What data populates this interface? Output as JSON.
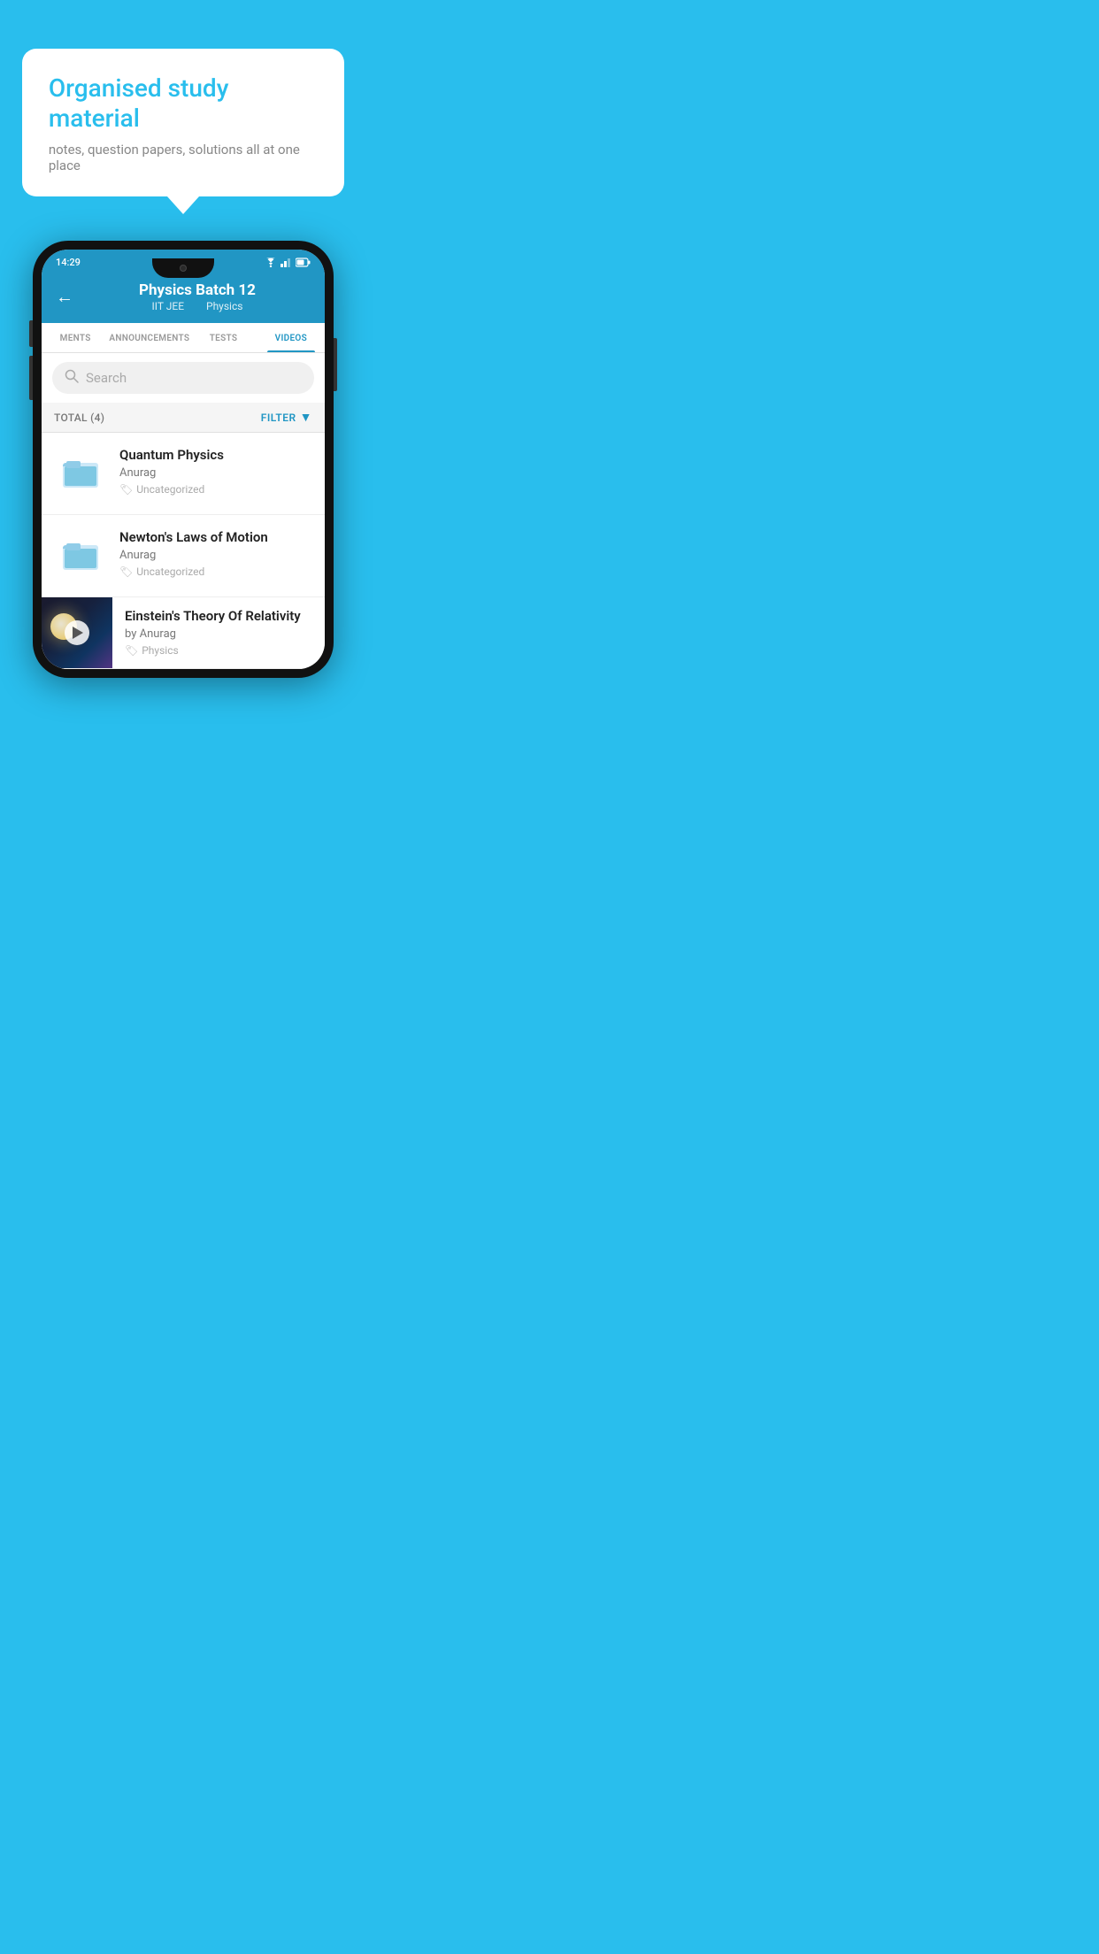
{
  "background_color": "#29BEED",
  "speech_bubble": {
    "title": "Organised study material",
    "subtitle": "notes, question papers, solutions all at one place"
  },
  "phone": {
    "status_bar": {
      "time": "14:29"
    },
    "header": {
      "title": "Physics Batch 12",
      "subtitle_left": "IIT JEE",
      "subtitle_right": "Physics",
      "back_label": "←"
    },
    "tabs": [
      {
        "label": "MENTS",
        "active": false
      },
      {
        "label": "ANNOUNCEMENTS",
        "active": false
      },
      {
        "label": "TESTS",
        "active": false
      },
      {
        "label": "VIDEOS",
        "active": true
      }
    ],
    "search": {
      "placeholder": "Search"
    },
    "filter_bar": {
      "total_label": "TOTAL (4)",
      "filter_label": "FILTER"
    },
    "videos": [
      {
        "title": "Quantum Physics",
        "author": "Anurag",
        "tag": "Uncategorized",
        "type": "folder"
      },
      {
        "title": "Newton's Laws of Motion",
        "author": "Anurag",
        "tag": "Uncategorized",
        "type": "folder"
      },
      {
        "title": "Einstein's Theory Of Relativity",
        "author": "by Anurag",
        "tag": "Physics",
        "type": "video"
      }
    ]
  }
}
